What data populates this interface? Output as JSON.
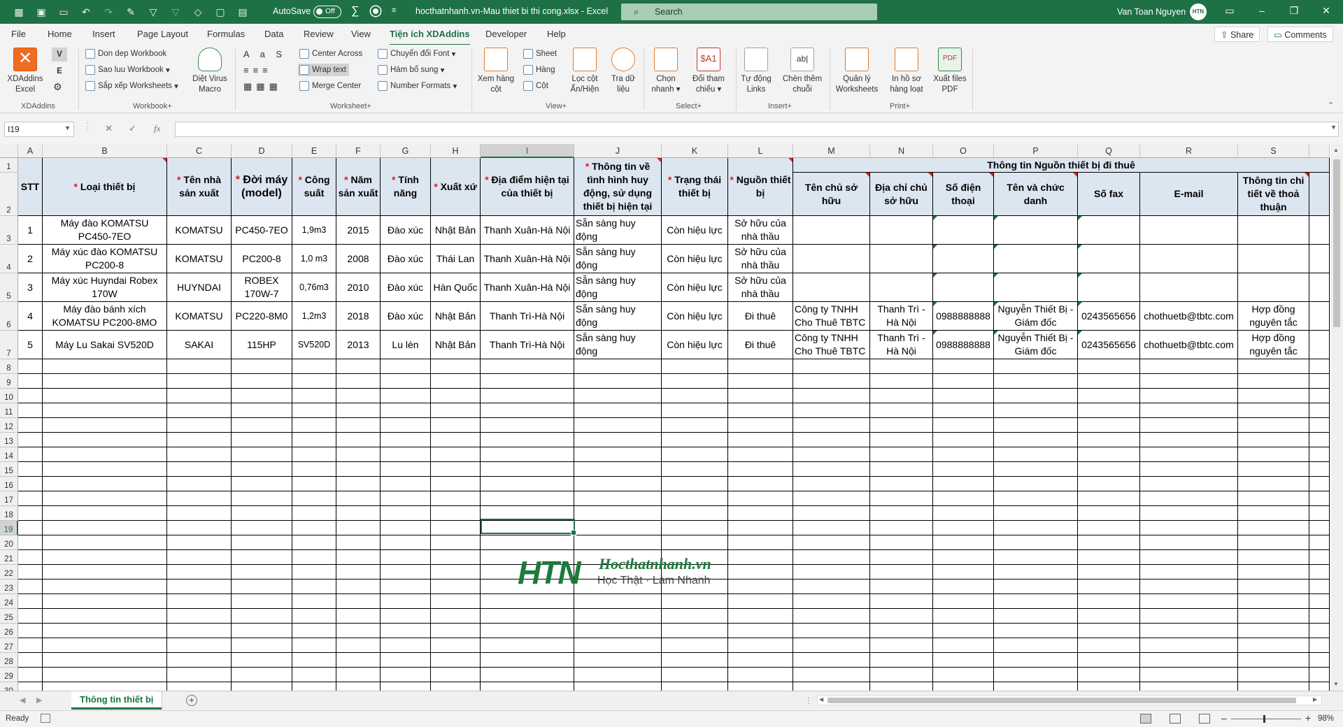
{
  "titlebar": {
    "autosave_label": "AutoSave",
    "autosave_state": "Off",
    "doc_title": "hocthatnhanh.vn-Mau thiet bi thi cong.xlsx  -  Excel",
    "search_placeholder": "Search",
    "user_name": "Van Toan Nguyen",
    "avatar_text": "HTN"
  },
  "tabs": [
    "File",
    "Home",
    "Insert",
    "Page Layout",
    "Formulas",
    "Data",
    "Review",
    "View",
    "Tiện ích XDAddins",
    "Developer",
    "Help"
  ],
  "share_label": "Share",
  "comments_label": "Comments",
  "ribbon": {
    "xdaddins": "XDAddins Excel",
    "v_label": "V",
    "e_label": "E",
    "don_dep": "Don dep Workbook",
    "sao_luu": "Sao luu Workbook",
    "sap_xep": "Sắp xếp Worksheets",
    "diet_virus": "Diệt Virus Macro",
    "center_across": "Center Across",
    "wrap_text": "Wrap text",
    "merge_center": "Merge Center",
    "chuyen_doi_font": "Chuyển đổi Font",
    "ham_bo_sung": "Hàm bổ sung",
    "number_formats": "Number Formats",
    "xem_hang_cot": "Xem hàng cột",
    "sheet": "Sheet",
    "hang": "Hàng",
    "cot": "Cột",
    "loc_cot": "Lọc cột Ẩn/Hiện",
    "tra_du_lieu": "Tra dữ liệu",
    "chon_nhanh": "Chọn nhanh",
    "doi_tham_chieu": "Đổi tham chiếu",
    "tu_dong_links": "Tự động Links",
    "chen_them_chuoi": "Chèn thêm chuỗi",
    "quan_ly_ws": "Quản lý Worksheets",
    "in_ho_so": "In hồ sơ hàng loạt",
    "xuat_pdf": "Xuất files PDF",
    "groups": {
      "g1": "XDAddins",
      "g2": "Workbook+",
      "g3": "Worksheet+",
      "g4": "View+",
      "g5": "Select+",
      "g6": "Insert+",
      "g7": "Print+"
    }
  },
  "formula_bar": {
    "name_box": "I19",
    "formula": ""
  },
  "columns": [
    "A",
    "B",
    "C",
    "D",
    "E",
    "F",
    "G",
    "H",
    "I",
    "J",
    "K",
    "L",
    "M",
    "N",
    "O",
    "P",
    "Q",
    "R",
    "S"
  ],
  "rows": [
    "1",
    "2",
    "3",
    "4",
    "5",
    "6",
    "7",
    "8",
    "9",
    "10",
    "11",
    "12",
    "13",
    "14",
    "15",
    "16",
    "17",
    "18",
    "19",
    "20",
    "21",
    "22",
    "23",
    "24",
    "25",
    "26",
    "27",
    "28",
    "29",
    "30"
  ],
  "table": {
    "h_stt": "STT",
    "h_b": "Loại thiết bị",
    "h_c": "Tên nhà sản xuất",
    "h_d": "Đời máy (model)",
    "h_e": "Công suất",
    "h_f": "Năm sản xuất",
    "h_g": "Tính năng",
    "h_h": "Xuất xứ",
    "h_i": "Địa điểm hiện tại của thiết bị",
    "h_j": "Thông tin về tình hình huy động, sử dụng thiết bị hiện tại",
    "h_k": "Trạng thái thiết bị",
    "h_l": "Nguồn thiết bị",
    "h_group": "Thông tin Nguồn thiết bị đi thuê",
    "h_m": "Tên chủ sở hữu",
    "h_n": "Địa chỉ chủ sở hữu",
    "h_o": "Số điện thoại",
    "h_p": "Tên và chức danh",
    "h_q": "Số fax",
    "h_r": "E-mail",
    "h_s": "Thông tin chi tiết về thoả thuận",
    "req": "*",
    "rows": [
      [
        "1",
        "Máy đào KOMATSU PC450-7EO",
        "KOMATSU",
        "PC450-7EO",
        "1,9m3",
        "2015",
        "Đào xúc",
        "Nhật Bản",
        "Thanh Xuân-Hà Nội",
        "Sẵn sàng huy động",
        "Còn hiệu lực",
        "Sở hữu của nhà thầu",
        "",
        "",
        "",
        "",
        "",
        "",
        ""
      ],
      [
        "2",
        "Máy xúc đào KOMATSU PC200-8",
        "KOMATSU",
        "PC200-8",
        "1,0 m3",
        "2008",
        "Đào xúc",
        "Thái Lan",
        "Thanh Xuân-Hà Nội",
        "Sẵn sàng huy động",
        "Còn hiệu lực",
        "Sở hữu của nhà thầu",
        "",
        "",
        "",
        "",
        "",
        "",
        ""
      ],
      [
        "3",
        "Máy xúc Huyndai Robex 170W",
        "HUYNDAI",
        "ROBEX 170W-7",
        "0,76m3",
        "2010",
        "Đào xúc",
        "Hàn Quốc",
        "Thanh Xuân-Hà Nội",
        "Sẵn sàng huy động",
        "Còn hiệu lực",
        "Sở hữu của nhà thầu",
        "",
        "",
        "",
        "",
        "",
        "",
        ""
      ],
      [
        "4",
        "Máy đào bánh xích KOMATSU PC200-8MO",
        "KOMATSU",
        "PC220-8M0",
        "1,2m3",
        "2018",
        "Đào xúc",
        "Nhật Bản",
        "Thanh Trì-Hà Nội",
        "Sẵn sàng huy động",
        "Còn hiệu lực",
        "Đi thuê",
        "Công ty TNHH Cho Thuê TBTC",
        "Thanh Trì - Hà Nội",
        "0988888888",
        "Nguyễn Thiết Bị - Giám đốc",
        "0243565656",
        "chothuetb@tbtc.com",
        "Hợp đồng nguyên tắc"
      ],
      [
        "5",
        "Máy Lu Sakai SV520D",
        "SAKAI",
        "115HP",
        "SV520D",
        "2013",
        "Lu lèn",
        "Nhật Bản",
        "Thanh Trì-Hà Nội",
        "Sẵn sàng huy động",
        "Còn hiệu lực",
        "Đi thuê",
        "Công ty TNHH Cho Thuê TBTC",
        "Thanh Trì - Hà Nội",
        "0988888888",
        "Nguyễn Thiết Bị - Giám đốc",
        "0243565656",
        "chothuetb@tbtc.com",
        "Hợp đồng nguyên tắc"
      ]
    ]
  },
  "watermark": {
    "brand": "HTN",
    "site": "Hocthatnhanh.vn",
    "slogan": "Học Thật · Làm Nhanh"
  },
  "sheet_tab": "Thông tin thiết bị",
  "status": {
    "ready": "Ready",
    "zoom": "98%"
  }
}
